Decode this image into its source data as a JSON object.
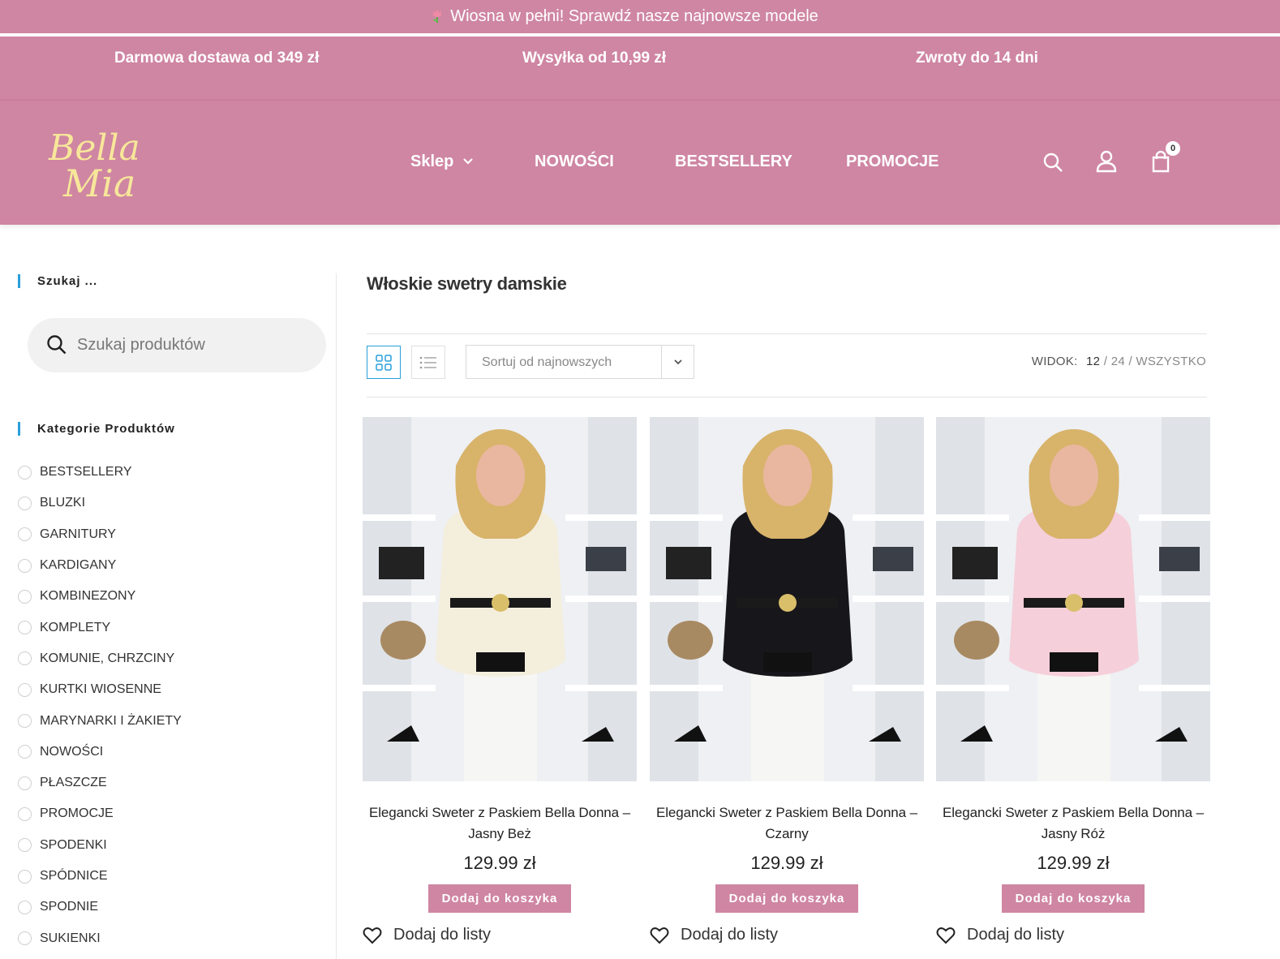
{
  "promo_bar": {
    "text": "Wiosna w pełni! Sprawdź nasze najnowsze modele"
  },
  "info_bar": {
    "items": [
      "Darmowa dostawa od 349 zł",
      "Wysyłka od 10,99 zł",
      "Zwroty do 14 dni"
    ]
  },
  "header": {
    "logo_text_line1": "Bella",
    "logo_text_line2": "Mia",
    "nav": [
      "Sklep",
      "NOWOŚCI",
      "BESTSELLERY",
      "PROMOCJE"
    ],
    "cart_count": "0"
  },
  "sidebar": {
    "search_title": "Szukaj ...",
    "search_placeholder": "Szukaj produktów",
    "categories_title": "Kategorie Produktów",
    "categories": [
      "BESTSELLERY",
      "BLUZKI",
      "GARNITURY",
      "KARDIGANY",
      "KOMBINEZONY",
      "KOMPLETY",
      "KOMUNIE, CHRZCINY",
      "KURTKI WIOSENNE",
      "MARYNARKI I ŻAKIETY",
      "NOWOŚCI",
      "PŁASZCZE",
      "PROMOCJE",
      "SPODENKI",
      "SPÓDNICE",
      "SPODNIE",
      "SUKIENKI"
    ]
  },
  "main": {
    "title": "Włoskie swetry damskie",
    "sort_value": "Sortuj od najnowszych",
    "widok_label": "WIDOK:",
    "widok_options": [
      "12",
      "24",
      "WSZYSTKO"
    ],
    "widok_separator": " / ",
    "products": [
      {
        "name": "Elegancki Sweter z Paskiem Bella Donna – Jasny Beż",
        "price": "129.99 zł",
        "add_label": "Dodaj do koszyka",
        "wish_label": "Dodaj do listy",
        "sweater_color": "#f4eedd"
      },
      {
        "name": "Elegancki Sweter z Paskiem Bella Donna – Czarny",
        "price": "129.99 zł",
        "add_label": "Dodaj do koszyka",
        "wish_label": "Dodaj do listy",
        "sweater_color": "#17171b"
      },
      {
        "name": "Elegancki Sweter z Paskiem Bella Donna – Jasny Róż",
        "price": "129.99 zł",
        "add_label": "Dodaj do koszyka",
        "wish_label": "Dodaj do listy",
        "sweater_color": "#f5cfda"
      }
    ]
  },
  "colors": {
    "brand_pink": "#cf86a2",
    "accent_blue": "#29a0da",
    "logo_yellow": "#f7e79a"
  }
}
